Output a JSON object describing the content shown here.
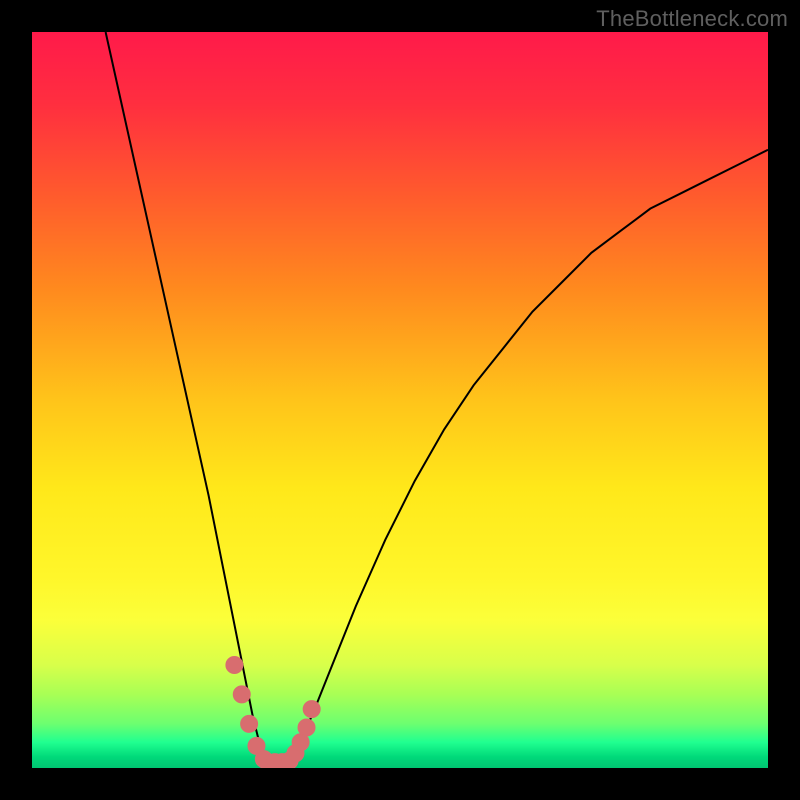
{
  "watermark": "TheBottleneck.com",
  "colors": {
    "frame": "#000000",
    "curve_stroke": "#000000",
    "marker_fill": "#d86d6f",
    "marker_stroke": "#d86d6f",
    "gradient_stops": [
      {
        "offset": 0.0,
        "color": "#ff1a4a"
      },
      {
        "offset": 0.1,
        "color": "#ff2f3f"
      },
      {
        "offset": 0.22,
        "color": "#ff5a2d"
      },
      {
        "offset": 0.35,
        "color": "#ff8a1e"
      },
      {
        "offset": 0.5,
        "color": "#ffc41a"
      },
      {
        "offset": 0.62,
        "color": "#ffe81a"
      },
      {
        "offset": 0.74,
        "color": "#fff62a"
      },
      {
        "offset": 0.8,
        "color": "#fbff3a"
      },
      {
        "offset": 0.86,
        "color": "#d8ff4a"
      },
      {
        "offset": 0.9,
        "color": "#a8ff55"
      },
      {
        "offset": 0.94,
        "color": "#6cff70"
      },
      {
        "offset": 0.965,
        "color": "#20ff90"
      },
      {
        "offset": 0.985,
        "color": "#00d97a"
      },
      {
        "offset": 1.0,
        "color": "#00c572"
      }
    ]
  },
  "chart_data": {
    "type": "line",
    "title": "",
    "xlabel": "",
    "ylabel": "",
    "xlim": [
      0,
      100
    ],
    "ylim": [
      0,
      100
    ],
    "grid": false,
    "series": [
      {
        "name": "bottleneck-curve",
        "x": [
          10,
          12,
          14,
          16,
          18,
          20,
          22,
          24,
          26,
          27,
          28,
          29,
          30,
          31,
          32,
          33,
          34,
          35,
          36,
          38,
          40,
          44,
          48,
          52,
          56,
          60,
          64,
          68,
          72,
          76,
          80,
          84,
          88,
          92,
          96,
          100
        ],
        "y": [
          100,
          91,
          82,
          73,
          64,
          55,
          46,
          37,
          27,
          22,
          17,
          12,
          7,
          3,
          1,
          0.5,
          0.5,
          1,
          3,
          7,
          12,
          22,
          31,
          39,
          46,
          52,
          57,
          62,
          66,
          70,
          73,
          76,
          78,
          80,
          82,
          84
        ]
      }
    ],
    "markers": {
      "name": "highlight-region",
      "x": [
        27.5,
        28.5,
        29.5,
        30.5,
        31.5,
        32.0,
        33.0,
        34.0,
        35.0,
        35.8,
        36.5,
        37.3,
        38.0
      ],
      "y": [
        14,
        10,
        6,
        3,
        1.2,
        0.8,
        0.8,
        0.8,
        1.0,
        2.0,
        3.5,
        5.5,
        8.0
      ]
    }
  }
}
